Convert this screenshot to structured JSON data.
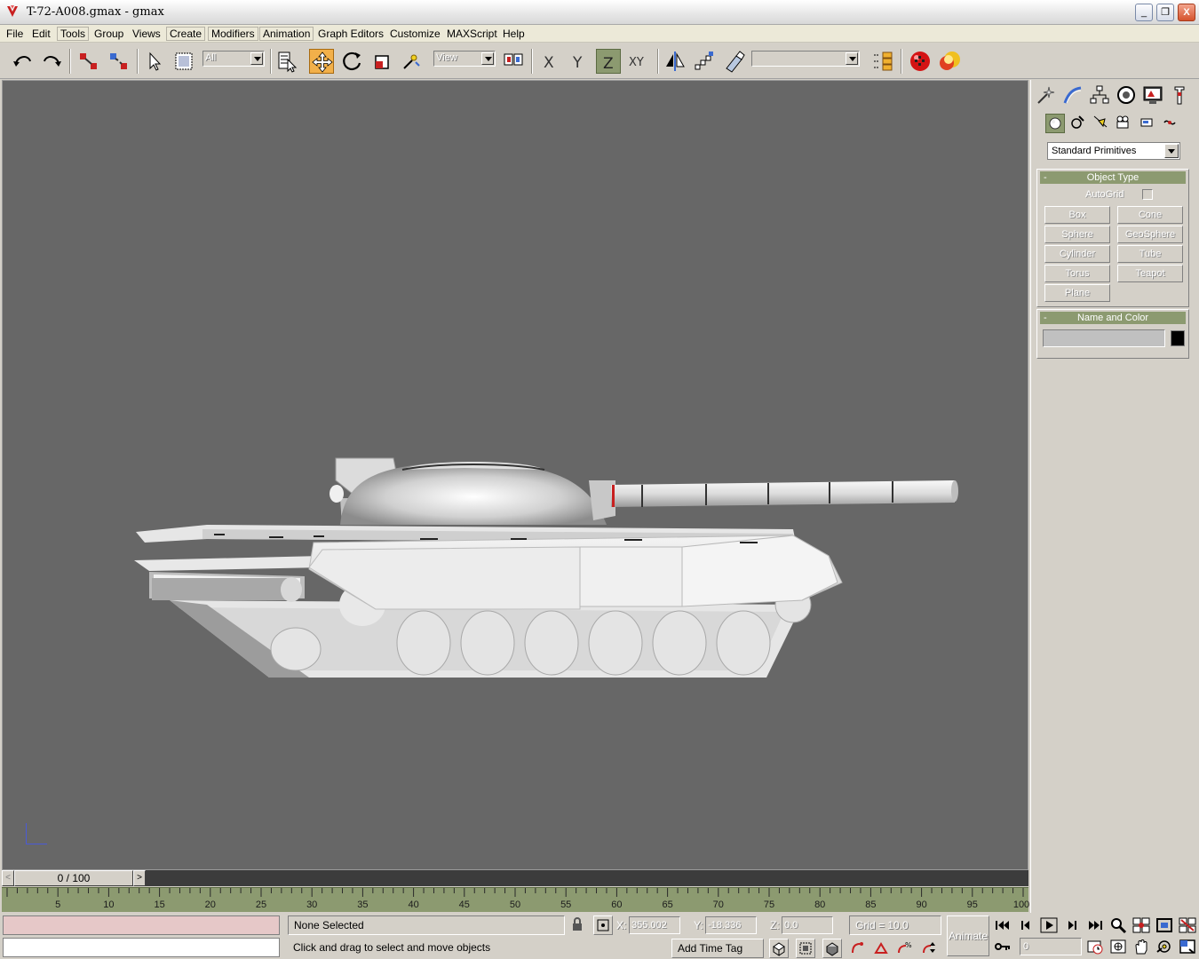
{
  "window": {
    "title": "T-72-A008.gmax - gmax",
    "minimize": "_",
    "restore": "❐",
    "close": "X"
  },
  "menu": {
    "file": "File",
    "edit": "Edit",
    "tools": "Tools",
    "group": "Group",
    "views": "Views",
    "create": "Create",
    "modifiers": "Modifiers",
    "animation": "Animation",
    "graph_editors": "Graph Editors",
    "customize": "Customize",
    "maxscript": "MAXScript",
    "help": "Help"
  },
  "toolbar": {
    "selection_filter": "All",
    "ref_coord": "View",
    "named_selection": "",
    "active_tool": "select-and-move",
    "active_axis": "Z",
    "x_axis": "X",
    "y_axis": "Y",
    "z_axis": "Z",
    "xy_axis": "XY"
  },
  "command_panel": {
    "category": "Standard Primitives",
    "object_type": {
      "title": "Object Type",
      "collapse": "-",
      "autogrid": "AutoGrid",
      "buttons": [
        "Box",
        "Cone",
        "Sphere",
        "GeoSphere",
        "Cylinder",
        "Tube",
        "Torus",
        "Teapot",
        "Plane"
      ]
    },
    "name_and_color": {
      "title": "Name and Color",
      "collapse": "-",
      "name": "",
      "color": "#000000"
    }
  },
  "timeline": {
    "frame_display": "0 / 100",
    "prev": "<",
    "next": ">",
    "ticks": [
      "5",
      "10",
      "15",
      "20",
      "25",
      "30",
      "35",
      "40",
      "45",
      "50",
      "55",
      "60",
      "65",
      "70",
      "75",
      "80",
      "85",
      "90",
      "95",
      "100"
    ]
  },
  "status": {
    "selection": "None Selected",
    "prompt": "Click and drag to select and move objects",
    "x_label": "X:",
    "x_value": "355.002",
    "y_label": "Y:",
    "y_value": "-18.336",
    "z_label": "Z:",
    "z_value": "0.0",
    "grid": "Grid = 10.0",
    "add_time_tag": "Add Time Tag",
    "animate": "Animate",
    "current_frame": "0"
  },
  "colors": {
    "viewport_bg": "#676767",
    "active_tool": "#f2b04a",
    "rollout_header": "#8c9a70",
    "trackbar": "#8c9a70"
  }
}
